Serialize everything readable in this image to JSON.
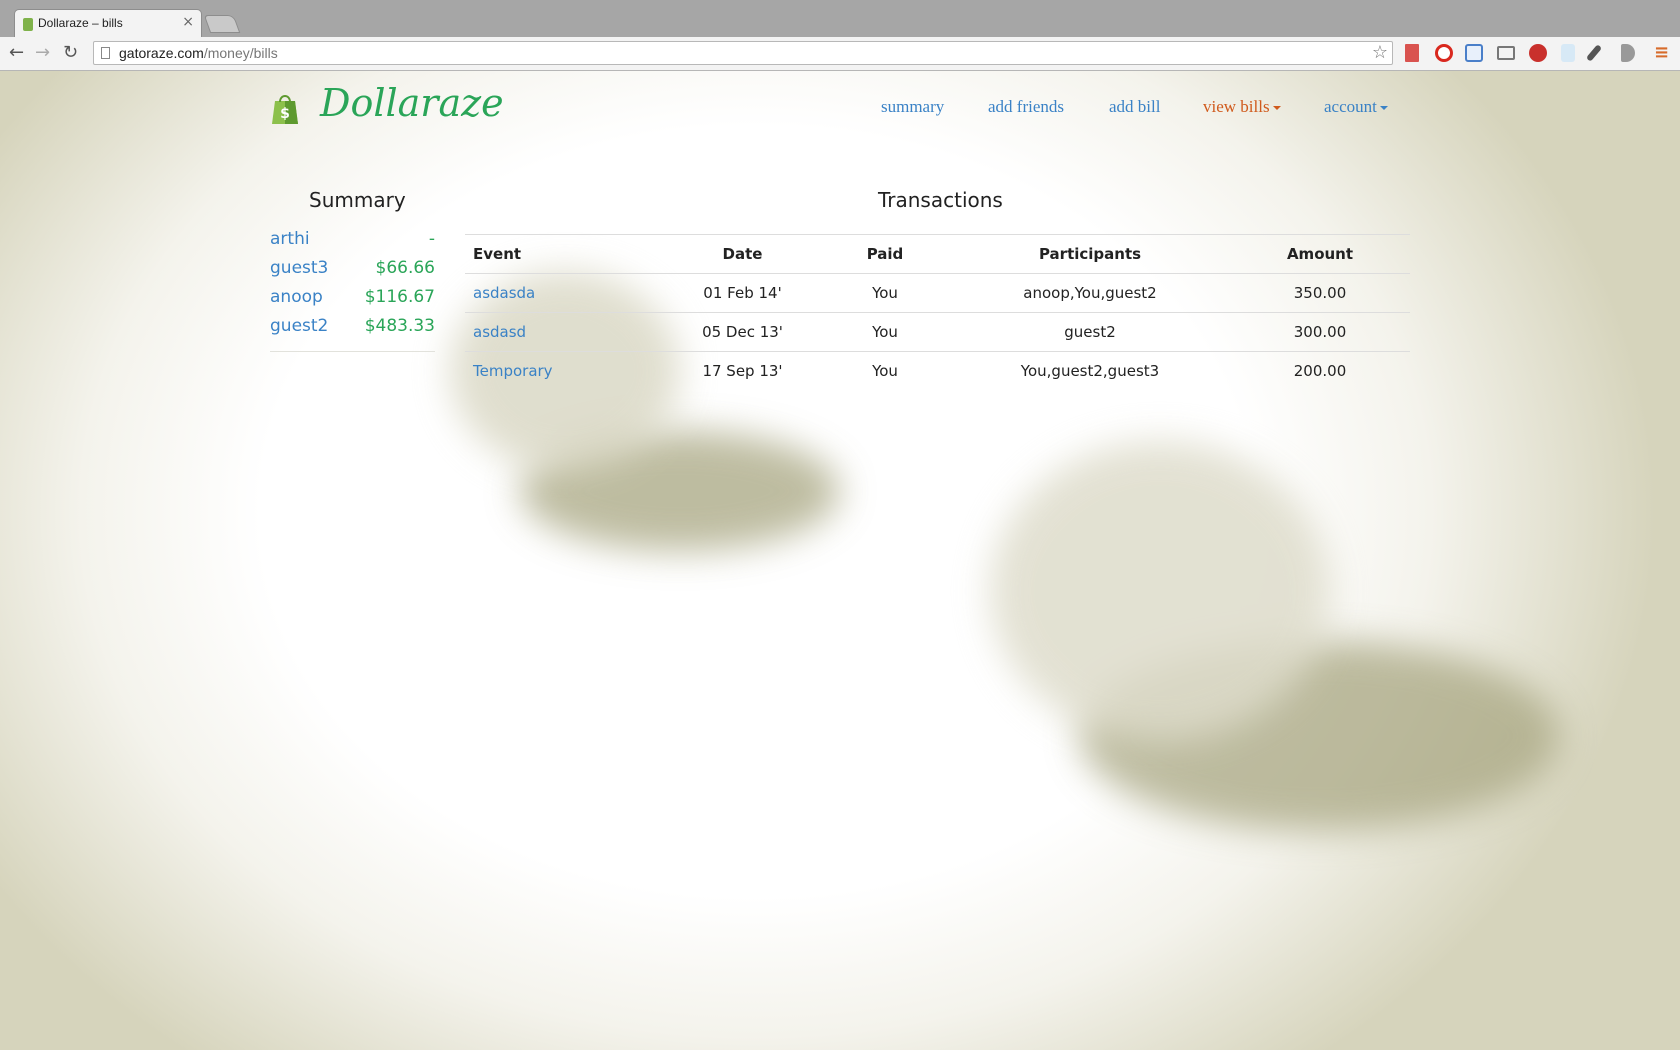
{
  "browser": {
    "tab_title": "Dollaraze – bills",
    "tab_close": "×",
    "url_host": "gatoraze.com",
    "url_path": "/money/bills",
    "back_icon": "←",
    "forward_icon": "→",
    "reload_icon": "↻",
    "star_icon": "☆",
    "menu_icon": "≡"
  },
  "navbar": {
    "brand": "Dollaraze",
    "links": {
      "summary": "summary",
      "add_friends": "add friends",
      "add_bill": "add bill",
      "view_bills": "view bills",
      "account": "account"
    }
  },
  "summary": {
    "title": "Summary",
    "items": [
      {
        "name": "arthi",
        "amount": "-"
      },
      {
        "name": "guest3",
        "amount": "$66.66"
      },
      {
        "name": "anoop",
        "amount": "$116.67"
      },
      {
        "name": "guest2",
        "amount": "$483.33"
      }
    ]
  },
  "transactions": {
    "title": "Transactions",
    "headers": {
      "event": "Event",
      "date": "Date",
      "paid": "Paid",
      "participants": "Participants",
      "amount": "Amount"
    },
    "rows": [
      {
        "event": "asdasda",
        "date": "01 Feb 14'",
        "paid": "You",
        "participants": "anoop,You,guest2",
        "amount": "350.00"
      },
      {
        "event": "asdasd",
        "date": "05 Dec 13'",
        "paid": "You",
        "participants": "guest2",
        "amount": "300.00"
      },
      {
        "event": "Temporary",
        "date": "17 Sep 13'",
        "paid": "You",
        "participants": "You,guest2,guest3",
        "amount": "200.00"
      }
    ]
  },
  "colors": {
    "link": "#3a82c6",
    "active_link": "#d05a1c",
    "brand_green": "#2aa558"
  }
}
